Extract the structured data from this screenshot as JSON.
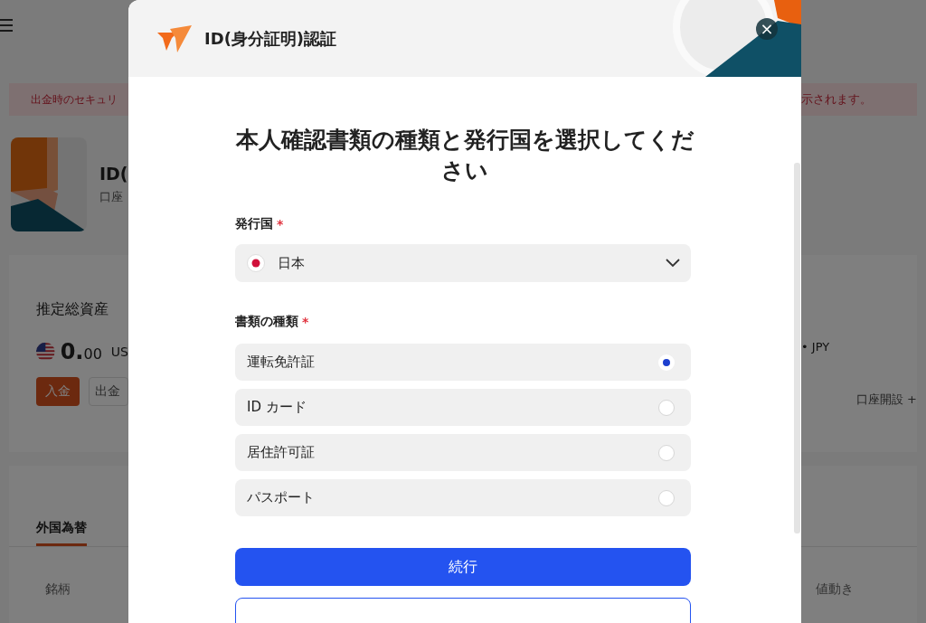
{
  "alert": {
    "left_text": "出金時のセキュリ",
    "right_text": "示されます。"
  },
  "profile_card": {
    "title": "ID(",
    "subtitle": "口座"
  },
  "assets": {
    "label": "推定総資産",
    "amount_int": "0.",
    "amount_dec": "00",
    "currency": "US",
    "secondary": "• JPY",
    "open_account": "口座開設 +",
    "buttons": [
      {
        "label": "入金",
        "kind": "primary"
      },
      {
        "label": "出金",
        "kind": "secondary"
      }
    ]
  },
  "markets": {
    "tabs": [
      {
        "label": "外国為替",
        "selected": true
      }
    ],
    "columns": [
      "銘柄",
      "値動き"
    ]
  },
  "modal": {
    "title": "ID(身分証明)認証",
    "close": "×",
    "heading": "本人確認書類の種類と発行国を選択してください",
    "country": {
      "label": "発行国",
      "required_mark": "*",
      "value": "日本"
    },
    "document_type": {
      "label": "書類の種類",
      "required_mark": "*",
      "options": [
        {
          "label": "運転免許証",
          "selected": true
        },
        {
          "label": "ID カード",
          "selected": false
        },
        {
          "label": "居住許可証",
          "selected": false
        },
        {
          "label": "パスポート",
          "selected": false
        }
      ]
    },
    "continue_button": "続行"
  }
}
